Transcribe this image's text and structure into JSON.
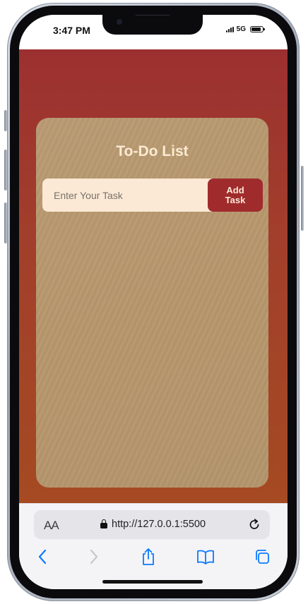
{
  "status_bar": {
    "time": "3:47 PM",
    "network": "5G",
    "signal_icon": "signal-bars-icon",
    "battery_icon": "battery-icon"
  },
  "todo_app": {
    "title": "To-Do List",
    "input": {
      "placeholder": "Enter Your Task",
      "value": ""
    },
    "add_button_label": "Add Task",
    "tasks": [],
    "colors": {
      "background_top": "#9c3030",
      "background_bottom": "#a54a22",
      "card": "#b8996f",
      "title": "#fbead2",
      "input_bg": "#fbe9d6",
      "button": "#a02b2d"
    }
  },
  "browser": {
    "text_size_label": "AA",
    "url": "http://127.0.0.1:5500",
    "icons": {
      "lock": "lock-icon",
      "reload": "reload-icon",
      "back": "back-chevron-icon",
      "forward": "forward-chevron-icon",
      "share": "share-icon",
      "bookmarks": "bookmarks-icon",
      "tabs": "tabs-icon"
    },
    "accent_color": "#0a7aff"
  }
}
